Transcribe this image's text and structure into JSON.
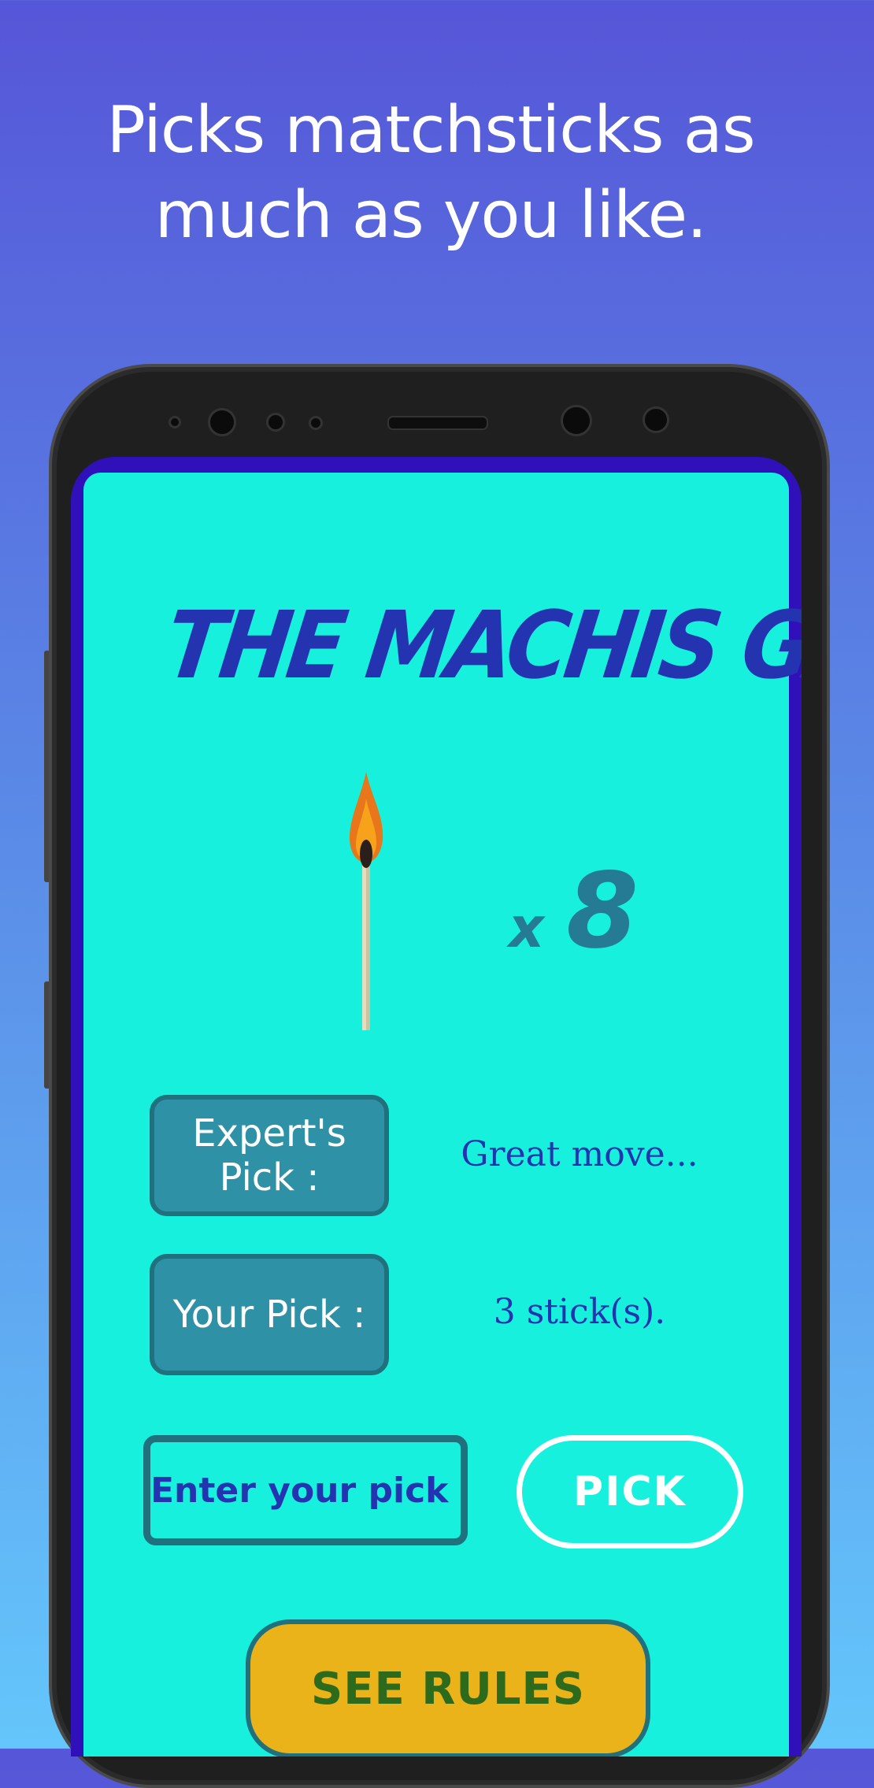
{
  "promo": {
    "headline_line1": "Picks matchsticks as",
    "headline_line2": "much as you like."
  },
  "app": {
    "title": "THE MACHIS GAME",
    "matchstick_icon": "matchstick-icon",
    "count_prefix": "x",
    "count_value": "8",
    "experts_pick_label_line1": "Expert's",
    "experts_pick_label_line2": "Pick :",
    "experts_pick_value": "Great move...",
    "your_pick_label": "Your Pick :",
    "your_pick_value": "3 stick(s).",
    "pick_input_placeholder": "Enter your pick :",
    "pick_button_label": "PICK",
    "rules_button_label": "SEE RULES"
  },
  "colors": {
    "background_top": "#5656d8",
    "background_bottom": "#64c6fb",
    "app_background": "#17f0dc",
    "title_color": "#2433b0",
    "accent_dark": "#21707d",
    "label_box": "#2e91a6",
    "rules_button": "#eab31a",
    "rules_text": "#2d6a1c"
  }
}
